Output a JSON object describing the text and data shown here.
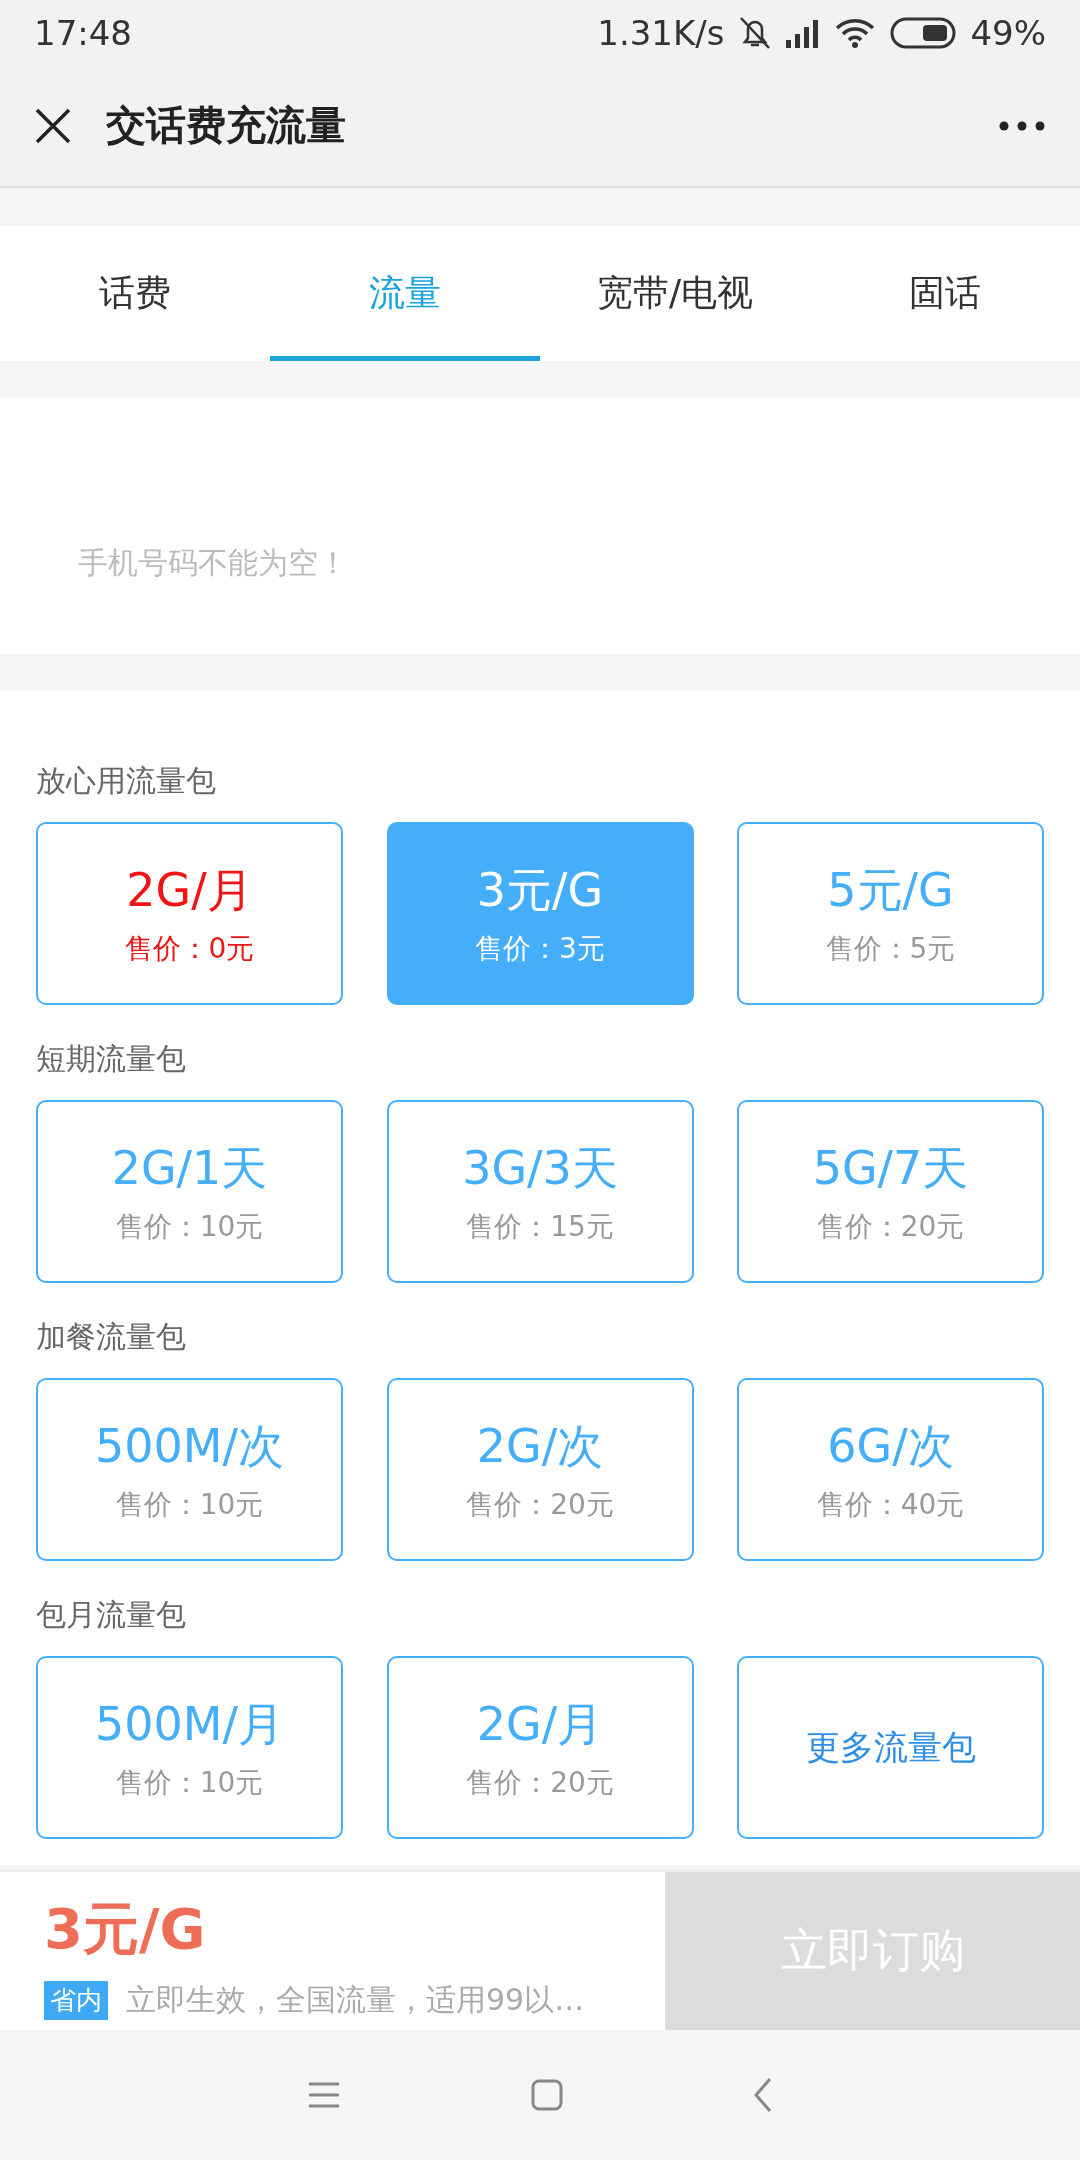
{
  "status_bar": {
    "time": "17:48",
    "speed": "1.31K/s",
    "battery": "49%"
  },
  "header": {
    "title": "交话费充流量"
  },
  "tabs": [
    {
      "label": "话费",
      "selected": false
    },
    {
      "label": "流量",
      "selected": true
    },
    {
      "label": "宽带/电视",
      "selected": false
    },
    {
      "label": "固话",
      "selected": false
    }
  ],
  "phone": {
    "error": "手机号码不能为空！"
  },
  "sections": [
    {
      "title": "放心用流量包",
      "items": [
        {
          "kind": "package",
          "name": "2G/月",
          "price": "售价：0元",
          "highlight": true,
          "selected": false
        },
        {
          "kind": "package",
          "name": "3元/G",
          "price": "售价：3元",
          "highlight": false,
          "selected": true
        },
        {
          "kind": "package",
          "name": "5元/G",
          "price": "售价：5元",
          "highlight": false,
          "selected": false
        }
      ]
    },
    {
      "title": "短期流量包",
      "items": [
        {
          "kind": "package",
          "name": "2G/1天",
          "price": "售价：10元",
          "highlight": false,
          "selected": false
        },
        {
          "kind": "package",
          "name": "3G/3天",
          "price": "售价：15元",
          "highlight": false,
          "selected": false
        },
        {
          "kind": "package",
          "name": "5G/7天",
          "price": "售价：20元",
          "highlight": false,
          "selected": false
        }
      ]
    },
    {
      "title": "加餐流量包",
      "items": [
        {
          "kind": "package",
          "name": "500M/次",
          "price": "售价：10元",
          "highlight": false,
          "selected": false
        },
        {
          "kind": "package",
          "name": "2G/次",
          "price": "售价：20元",
          "highlight": false,
          "selected": false
        },
        {
          "kind": "package",
          "name": "6G/次",
          "price": "售价：40元",
          "highlight": false,
          "selected": false
        }
      ]
    },
    {
      "title": "包月流量包",
      "items": [
        {
          "kind": "package",
          "name": "500M/月",
          "price": "售价：10元",
          "highlight": false,
          "selected": false
        },
        {
          "kind": "package",
          "name": "2G/月",
          "price": "售价：20元",
          "highlight": false,
          "selected": false
        },
        {
          "kind": "more",
          "label": "更多流量包"
        }
      ]
    }
  ],
  "order_bar": {
    "price": "3元/G",
    "tag": "省内",
    "description": "立即生效，全国流量，适用99以…",
    "button": "立即订购",
    "disabled": true
  }
}
